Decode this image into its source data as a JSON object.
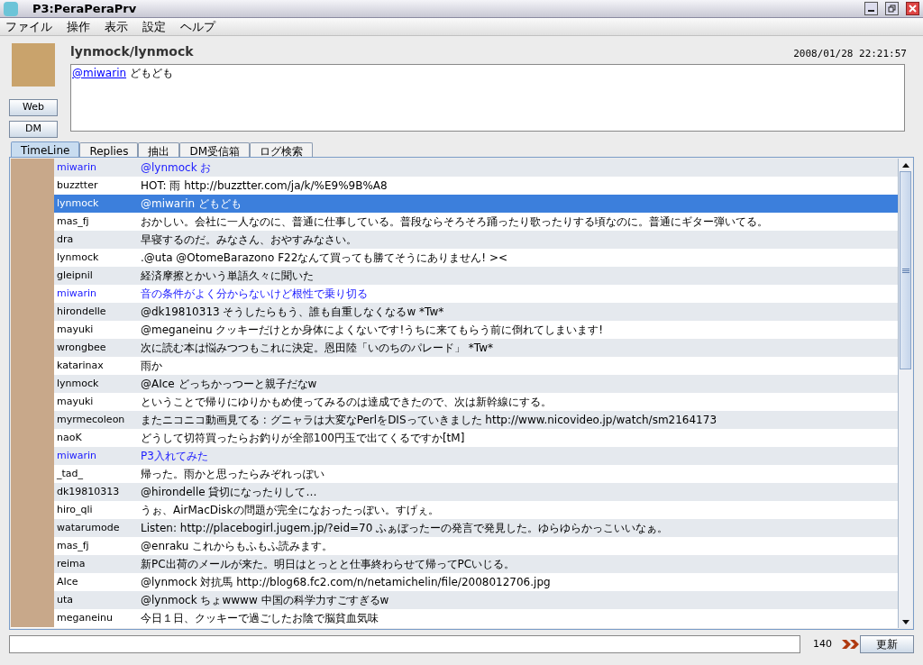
{
  "window": {
    "title": "P3:PeraPeraPrv"
  },
  "menu": [
    "ファイル",
    "操作",
    "表示",
    "設定",
    "ヘルプ"
  ],
  "header": {
    "user": "lynmock/lynmock",
    "timestamp": "2008/01/28 22:21:57",
    "mention": "@miwarin",
    "message": "どもども",
    "buttons": [
      "Web",
      "DM"
    ]
  },
  "tabs": [
    {
      "label": "TimeLine",
      "selected": true
    },
    {
      "label": "Replies",
      "selected": false
    },
    {
      "label": "抽出",
      "selected": false
    },
    {
      "label": "DM受信箱",
      "selected": false
    },
    {
      "label": "ログ検索",
      "selected": false
    }
  ],
  "rows": [
    {
      "user": "miwarin",
      "text": "@lynmock お",
      "highlighted": true,
      "selected": false
    },
    {
      "user": "buzztter",
      "text": "HOT: 雨 http://buzztter.com/ja/k/%E9%9B%A8",
      "highlighted": false,
      "selected": false
    },
    {
      "user": "lynmock",
      "text": "@miwarin どもども",
      "highlighted": false,
      "selected": true
    },
    {
      "user": "mas_fj",
      "text": "おかしい。会社に一人なのに、普通に仕事している。普段ならそろそろ踊ったり歌ったりする頃なのに。普通にギター弾いてる。",
      "highlighted": false,
      "selected": false
    },
    {
      "user": "dra",
      "text": "早寝するのだ。みなさん、おやすみなさい。",
      "highlighted": false,
      "selected": false
    },
    {
      "user": "lynmock",
      "text": ".@uta @OtomeBarazono F22なんて買っても勝てそうにありません! ><",
      "highlighted": false,
      "selected": false
    },
    {
      "user": "gleipnil",
      "text": "経済摩擦とかいう単語久々に聞いた",
      "highlighted": false,
      "selected": false
    },
    {
      "user": "miwarin",
      "text": "音の条件がよく分からないけど根性で乗り切る",
      "highlighted": true,
      "selected": false
    },
    {
      "user": "hirondelle",
      "text": "@dk19810313  そうしたらもう、誰も自重しなくなるw *Tw*",
      "highlighted": false,
      "selected": false
    },
    {
      "user": "mayuki",
      "text": "@meganeinu クッキーだけとか身体によくないです!うちに来てもらう前に倒れてしまいます!",
      "highlighted": false,
      "selected": false
    },
    {
      "user": "wrongbee",
      "text": "次に読む本は悩みつつもこれに決定。恩田陸「いのちのパレード」 *Tw*",
      "highlighted": false,
      "selected": false
    },
    {
      "user": "katarinax",
      "text": "雨か",
      "highlighted": false,
      "selected": false
    },
    {
      "user": "lynmock",
      "text": "@AIce どっちかっつーと親子だなw",
      "highlighted": false,
      "selected": false
    },
    {
      "user": "mayuki",
      "text": "ということで帰りにゆりかもめ使ってみるのは達成できたので、次は新幹線にする。",
      "highlighted": false,
      "selected": false
    },
    {
      "user": "myrmecoleon",
      "text": "またニコニコ動画見てる : グニャラは大変なPerlをDISっていきました http://www.nicovideo.jp/watch/sm2164173",
      "highlighted": false,
      "selected": false
    },
    {
      "user": "naoK",
      "text": "どうして切符買ったらお釣りが全部100円玉で出てくるですか[tM]",
      "highlighted": false,
      "selected": false
    },
    {
      "user": "miwarin",
      "text": "P3入れてみた",
      "highlighted": true,
      "selected": false
    },
    {
      "user": "_tad_",
      "text": "帰った。雨かと思ったらみぞれっぽい",
      "highlighted": false,
      "selected": false
    },
    {
      "user": "dk19810313",
      "text": "@hirondelle 貸切になったりして…",
      "highlighted": false,
      "selected": false
    },
    {
      "user": "hiro_qli",
      "text": "うぉ、AirMacDiskの問題が完全になおったっぽい。すげぇ。",
      "highlighted": false,
      "selected": false
    },
    {
      "user": "watarumode",
      "text": "Listen: http://placebogirl.jugem.jp/?eid=70  ふぁぼったーの発言で発見した。ゆらゆらかっこいいなぁ。",
      "highlighted": false,
      "selected": false
    },
    {
      "user": "mas_fj",
      "text": "@enraku これからもふもふ読みます。",
      "highlighted": false,
      "selected": false
    },
    {
      "user": "reima",
      "text": "新PC出荷のメールが来た。明日はとっとと仕事終わらせて帰ってPCいじる。",
      "highlighted": false,
      "selected": false
    },
    {
      "user": "AIce",
      "text": "@lynmock 対抗馬 http://blog68.fc2.com/n/netamichelin/file/2008012706.jpg",
      "highlighted": false,
      "selected": false
    },
    {
      "user": "uta",
      "text": "@lynmock ちょwwww 中国の科学力すごすぎるw",
      "highlighted": false,
      "selected": false
    },
    {
      "user": "meganeinu",
      "text": "今日１日、クッキーで過ごしたお陰で脳貧血気味",
      "highlighted": false,
      "selected": false
    }
  ],
  "footer": {
    "count": "140",
    "button": "更新"
  }
}
